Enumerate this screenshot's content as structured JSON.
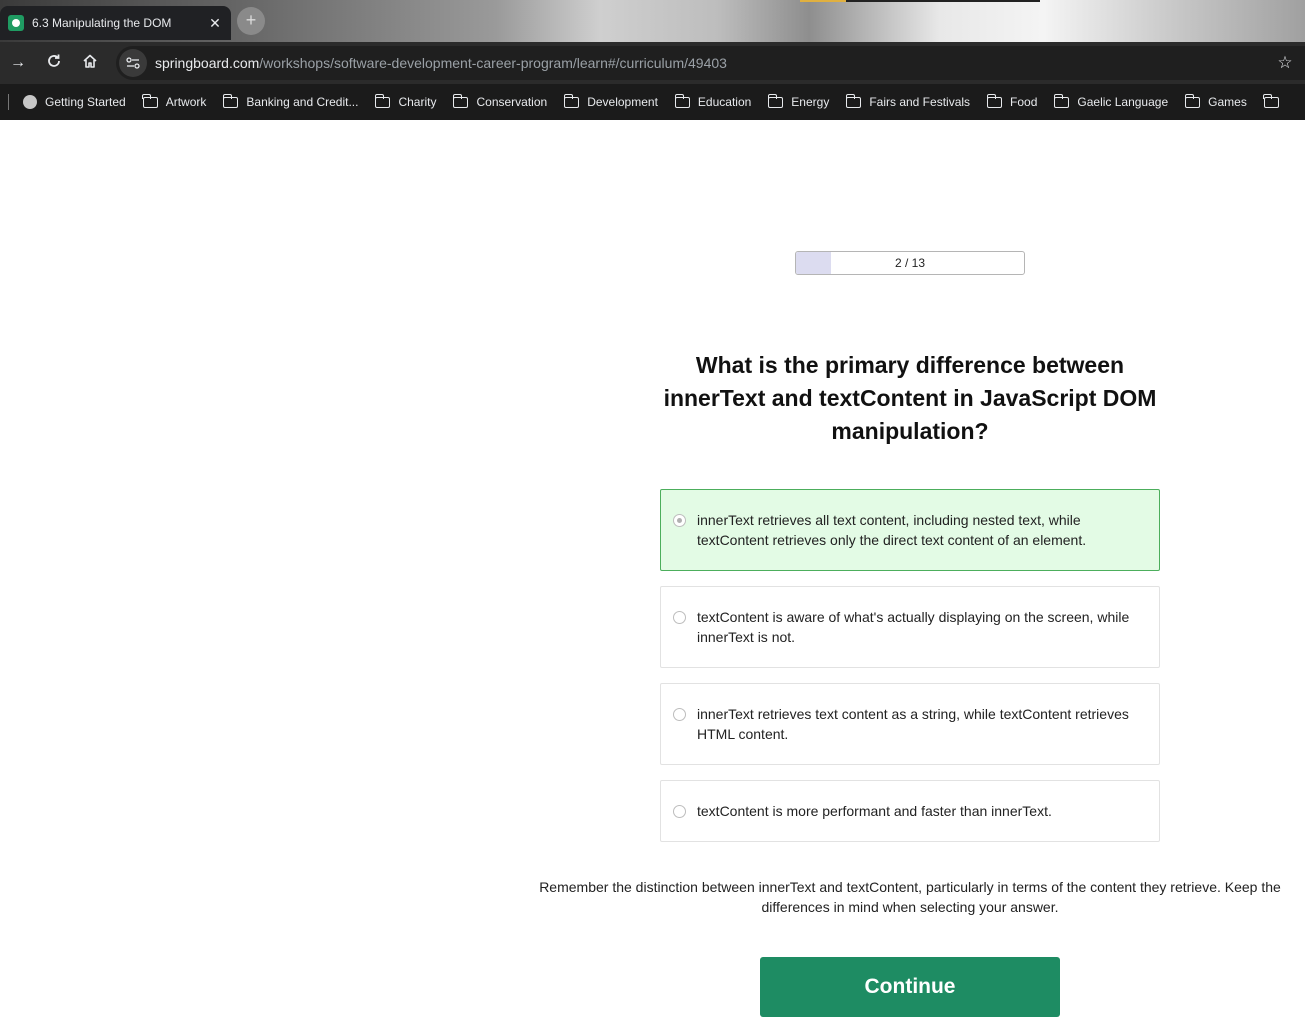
{
  "browser": {
    "tab_title": "6.3 Manipulating the DOM",
    "tab_close": "✕",
    "new_tab": "+",
    "url_host": "springboard.com",
    "url_path": "/workshops/software-development-career-program/learn#/curriculum/49403",
    "bookmarks": [
      "Getting Started",
      "Artwork",
      "Banking and Credit...",
      "Charity",
      "Conservation",
      "Development",
      "Education",
      "Energy",
      "Fairs and Festivals",
      "Food",
      "Gaelic Language",
      "Games"
    ]
  },
  "quiz": {
    "progress_label": "2 / 13",
    "progress_current": 2,
    "progress_total": 13,
    "question": "What is the primary difference between innerText and textContent in JavaScript DOM manipulation?",
    "options": [
      {
        "text": "innerText retrieves all text content, including nested text, while textContent retrieves only the direct text content of an element.",
        "selected": true
      },
      {
        "text": "textContent is aware of what's actually displaying on the screen, while innerText is not.",
        "selected": false
      },
      {
        "text": "innerText retrieves text content as a string, while textContent retrieves HTML content.",
        "selected": false
      },
      {
        "text": "textContent is more performant and faster than innerText.",
        "selected": false
      }
    ],
    "hint": "Remember the distinction between innerText and textContent, particularly in terms of the content they retrieve. Keep the differences in mind when selecting your answer.",
    "continue_label": "Continue"
  },
  "colors": {
    "selected_bg": "#e3fbe5",
    "selected_border": "#4cae5c",
    "continue_bg": "#1e8c63",
    "progress_fill": "#dcdcf0"
  }
}
